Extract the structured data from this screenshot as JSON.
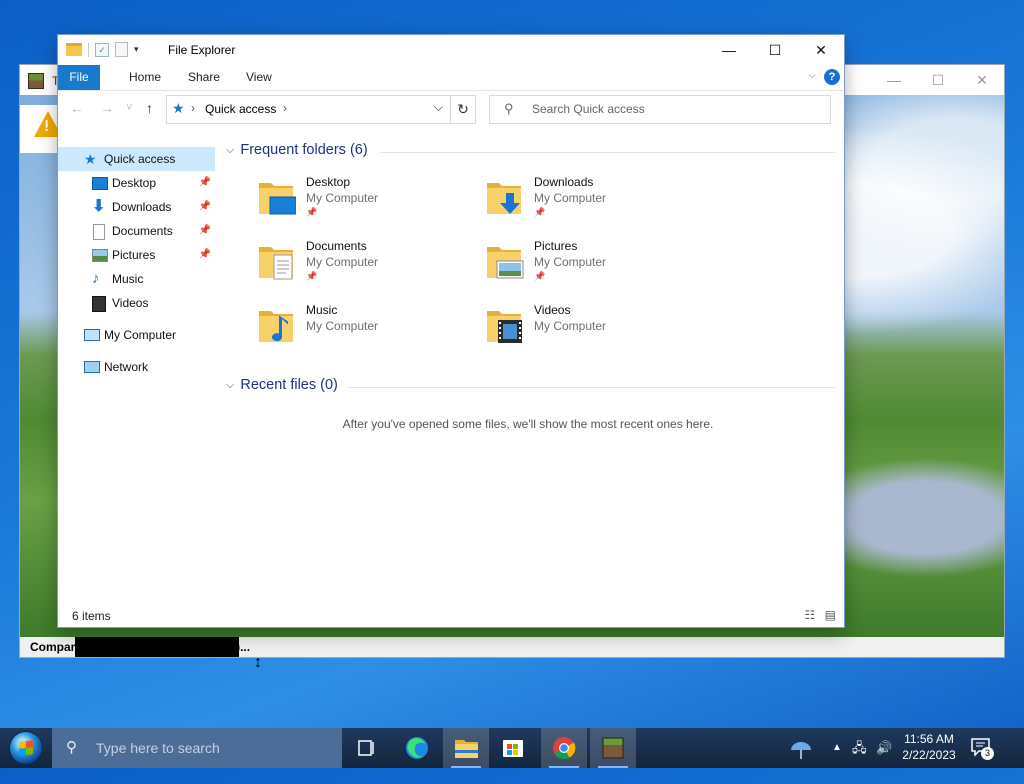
{
  "background_window": {
    "title": "T",
    "status": "Comparing assets (may take a while)...",
    "minimize": "—",
    "maximize": "☐",
    "close": "✕"
  },
  "explorer": {
    "title": "File Explorer",
    "window_controls": {
      "minimize": "—",
      "maximize": "☐",
      "close": "✕"
    },
    "ribbon_tabs": [
      "File",
      "Home",
      "Share",
      "View"
    ],
    "nav": {
      "back": "←",
      "forward": "→",
      "recent": "˅",
      "up": "↑"
    },
    "address": {
      "crumb": "Quick access",
      "sep1": "›",
      "sep2": "›",
      "dropdown": "⌵",
      "refresh": "↻"
    },
    "search": {
      "placeholder": "Search Quick access"
    },
    "sidebar": {
      "quick_access": "Quick access",
      "pinned": [
        {
          "label": "Desktop",
          "pinned": true
        },
        {
          "label": "Downloads",
          "pinned": true
        },
        {
          "label": "Documents",
          "pinned": true
        },
        {
          "label": "Pictures",
          "pinned": true
        },
        {
          "label": "Music",
          "pinned": false
        },
        {
          "label": "Videos",
          "pinned": false
        }
      ],
      "my_computer": "My Computer",
      "network": "Network"
    },
    "frequent": {
      "heading": "Frequent folders (6)",
      "items": [
        {
          "name": "Desktop",
          "location": "My Computer",
          "pinned": true,
          "icon": "desktop-folder-icon"
        },
        {
          "name": "Downloads",
          "location": "My Computer",
          "pinned": true,
          "icon": "downloads-folder-icon"
        },
        {
          "name": "Documents",
          "location": "My Computer",
          "pinned": true,
          "icon": "documents-folder-icon"
        },
        {
          "name": "Pictures",
          "location": "My Computer",
          "pinned": true,
          "icon": "pictures-folder-icon"
        },
        {
          "name": "Music",
          "location": "My Computer",
          "pinned": false,
          "icon": "music-folder-icon"
        },
        {
          "name": "Videos",
          "location": "My Computer",
          "pinned": false,
          "icon": "videos-folder-icon"
        }
      ]
    },
    "recent": {
      "heading": "Recent files (0)",
      "empty_message": "After you've opened some files, we'll show the most recent ones here."
    },
    "status": "6 items"
  },
  "taskbar": {
    "search_placeholder": "Type here to search",
    "time": "11:56 AM",
    "date": "2/22/2023",
    "notification_count": "3"
  },
  "colors": {
    "accent": "#1979ca",
    "selection": "#cce8ff",
    "folder": "#f2c94c",
    "heading": "#1e3287"
  }
}
